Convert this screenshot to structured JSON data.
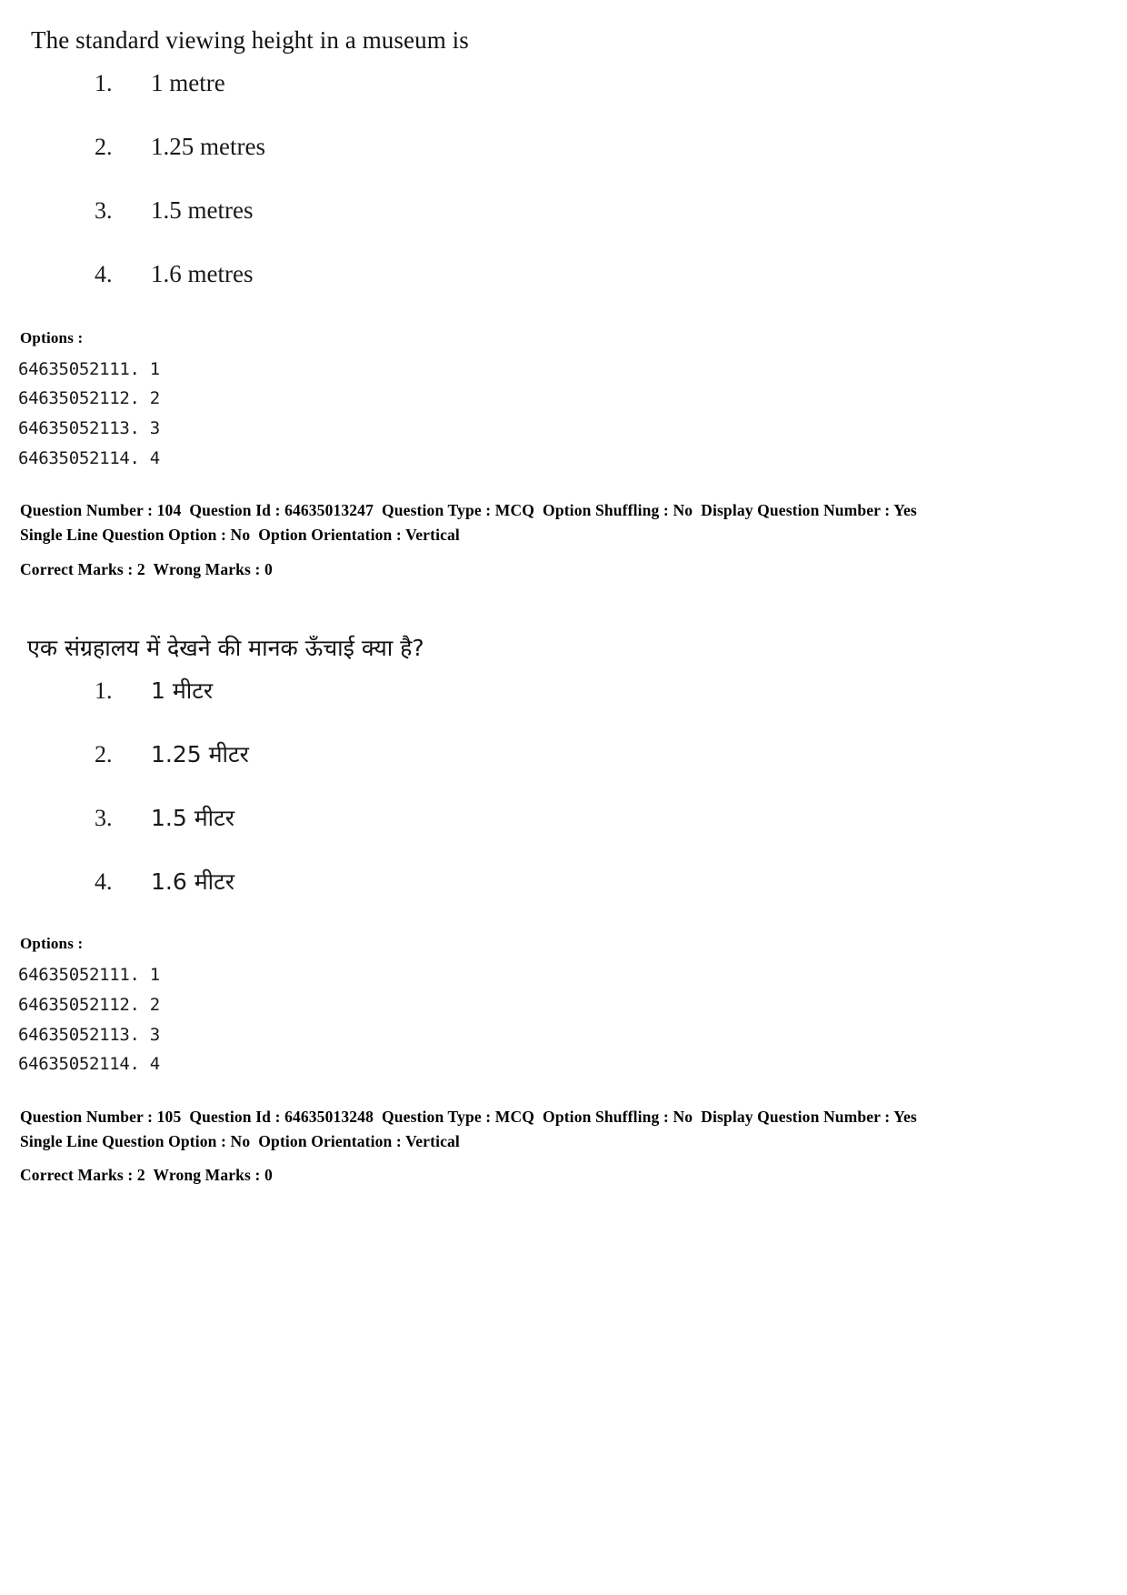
{
  "document": {
    "type": "exam-answer-key",
    "page_background": "#ffffff",
    "text_color": "#1a1a1a"
  },
  "questions": [
    {
      "language": "english",
      "question_text": "The standard viewing height in a museum is",
      "options": [
        {
          "index": "1.",
          "label": "1 metre"
        },
        {
          "index": "2.",
          "label": "1.25 metres"
        },
        {
          "index": "3.",
          "label": "1.5 metres"
        },
        {
          "index": "4.",
          "label": "1.6 metres"
        }
      ],
      "options_heading": "Options :",
      "option_ids": [
        "64635052111. 1",
        "64635052112. 2",
        "64635052113. 3",
        "64635052114. 4"
      ],
      "meta": {
        "line1": "Question Number : 104  Question Id : 64635013247  Question Type : MCQ  Option Shuffling : No  Display Question Number : Yes",
        "line2": "Single Line Question Option : No  Option Orientation : Vertical",
        "line3": "Correct Marks : 2  Wrong Marks : 0"
      }
    },
    {
      "language": "hindi",
      "question_text": "एक संग्रहालय में देखने की मानक ऊँचाई क्या है?",
      "options": [
        {
          "index": "1.",
          "label": "1 मीटर"
        },
        {
          "index": "2.",
          "label": "1.25 मीटर"
        },
        {
          "index": "3.",
          "label": "1.5 मीटर"
        },
        {
          "index": "4.",
          "label": "1.6 मीटर"
        }
      ],
      "options_heading": "Options :",
      "option_ids": [
        "64635052111. 1",
        "64635052112. 2",
        "64635052113. 3",
        "64635052114. 4"
      ],
      "meta": {
        "line1": "Question Number : 105  Question Id : 64635013248  Question Type : MCQ  Option Shuffling : No  Display Question Number : Yes",
        "line2": "Single Line Question Option : No  Option Orientation : Vertical",
        "line3": "Correct Marks : 2  Wrong Marks : 0"
      }
    }
  ]
}
